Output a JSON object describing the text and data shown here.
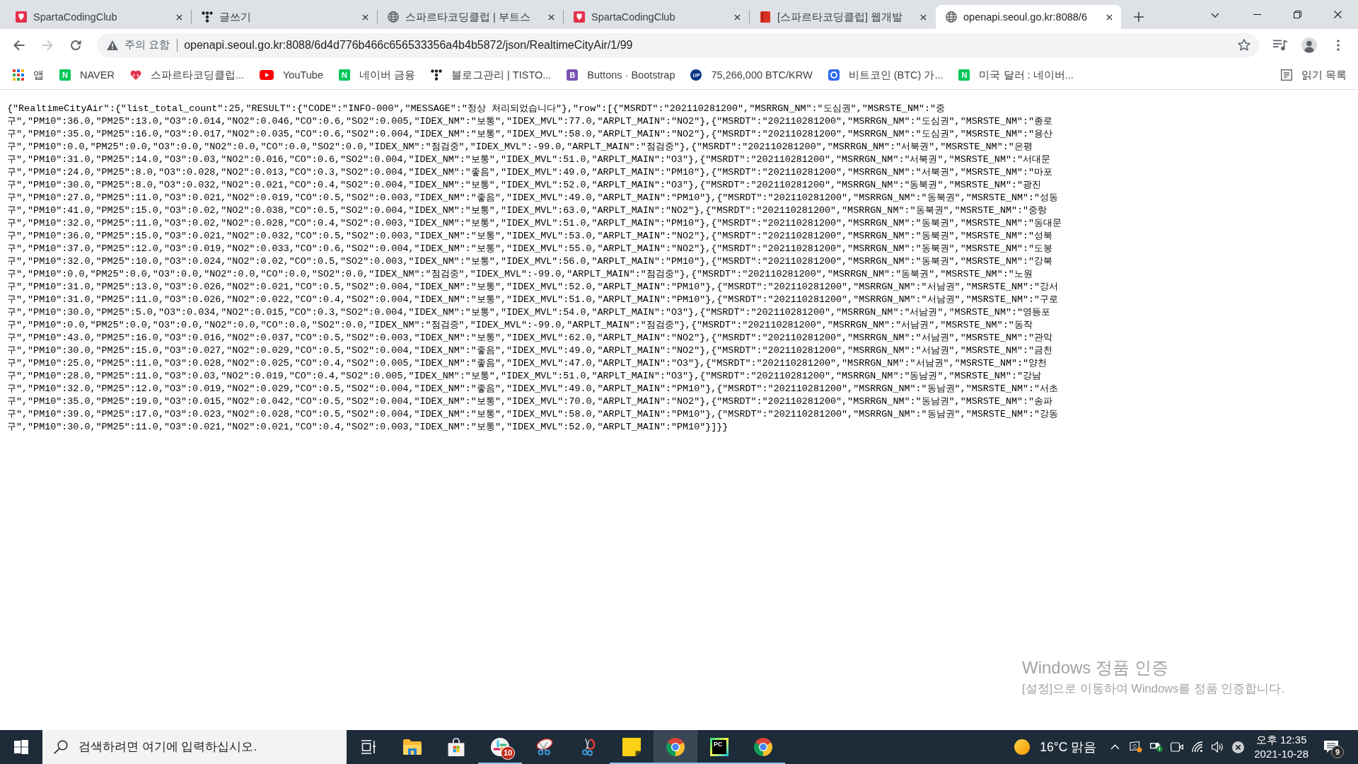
{
  "tabs": [
    {
      "title": "SpartaCodingClub",
      "kind": "sparta",
      "selected": false
    },
    {
      "title": "글쓰기",
      "kind": "tistory",
      "selected": false
    },
    {
      "title": "스파르타코딩클럽 | 부트스",
      "kind": "globe",
      "selected": false
    },
    {
      "title": "SpartaCodingClub",
      "kind": "sparta",
      "selected": false
    },
    {
      "title": "[스파르타코딩클럽] 웹개발",
      "kind": "book",
      "selected": false
    },
    {
      "title": "openapi.seoul.go.kr:8088/6",
      "kind": "globe",
      "selected": true
    }
  ],
  "nav_buttons": [
    {
      "kind": "back",
      "disabled": false
    },
    {
      "kind": "forward",
      "disabled": true
    },
    {
      "kind": "reload",
      "disabled": false
    }
  ],
  "address_bar": {
    "security_label": "주의 요함",
    "url": "openapi.seoul.go.kr:8088/6d4d776b466c656533356a4b4b5872/json/RealtimeCityAir/1/99",
    "bookmarked": false
  },
  "bookmarks": [
    {
      "label": "앱",
      "kind": "apps"
    },
    {
      "label": "NAVER",
      "kind": "naver",
      "glyph": "N"
    },
    {
      "label": "스파르타코딩클럽...",
      "kind": "heart"
    },
    {
      "label": "YouTube",
      "kind": "youtube"
    },
    {
      "label": "네이버 금융",
      "kind": "naver",
      "glyph": "N"
    },
    {
      "label": "블로그관리 | TISTO...",
      "kind": "tistory"
    },
    {
      "label": "Buttons · Bootstrap",
      "kind": "bootstrap",
      "glyph": "B"
    },
    {
      "label": "75,266,000 BTC/KRW",
      "kind": "upbit",
      "glyph": "UP"
    },
    {
      "label": "비트코인 (BTC) 가...",
      "kind": "coin"
    },
    {
      "label": "미국 달러 : 네이버...",
      "kind": "naver",
      "glyph": "N"
    }
  ],
  "reading_list": {
    "label": "읽기 목록"
  },
  "page": {
    "lines": [
      "{\"RealtimeCityAir\":{\"list_total_count\":25,\"RESULT\":{\"CODE\":\"INFO-000\",\"MESSAGE\":\"정상 처리되었습니다\"},\"row\":[{\"MSRDT\":\"202110281200\",\"MSRRGN_NM\":\"도심권\",\"MSRSTE_NM\":\"중",
      "구\",\"PM10\":36.0,\"PM25\":13.0,\"O3\":0.014,\"NO2\":0.046,\"CO\":0.6,\"SO2\":0.005,\"IDEX_NM\":\"보통\",\"IDEX_MVL\":77.0,\"ARPLT_MAIN\":\"NO2\"},{\"MSRDT\":\"202110281200\",\"MSRRGN_NM\":\"도심권\",\"MSRSTE_NM\":\"종로",
      "구\",\"PM10\":35.0,\"PM25\":16.0,\"O3\":0.017,\"NO2\":0.035,\"CO\":0.6,\"SO2\":0.004,\"IDEX_NM\":\"보통\",\"IDEX_MVL\":58.0,\"ARPLT_MAIN\":\"NO2\"},{\"MSRDT\":\"202110281200\",\"MSRRGN_NM\":\"도심권\",\"MSRSTE_NM\":\"용산",
      "구\",\"PM10\":0.0,\"PM25\":0.0,\"O3\":0.0,\"NO2\":0.0,\"CO\":0.0,\"SO2\":0.0,\"IDEX_NM\":\"점검중\",\"IDEX_MVL\":-99.0,\"ARPLT_MAIN\":\"점검중\"},{\"MSRDT\":\"202110281200\",\"MSRRGN_NM\":\"서북권\",\"MSRSTE_NM\":\"은평",
      "구\",\"PM10\":31.0,\"PM25\":14.0,\"O3\":0.03,\"NO2\":0.016,\"CO\":0.6,\"SO2\":0.004,\"IDEX_NM\":\"보통\",\"IDEX_MVL\":51.0,\"ARPLT_MAIN\":\"O3\"},{\"MSRDT\":\"202110281200\",\"MSRRGN_NM\":\"서북권\",\"MSRSTE_NM\":\"서대문",
      "구\",\"PM10\":24.0,\"PM25\":8.0,\"O3\":0.028,\"NO2\":0.013,\"CO\":0.3,\"SO2\":0.004,\"IDEX_NM\":\"좋음\",\"IDEX_MVL\":49.0,\"ARPLT_MAIN\":\"PM10\"},{\"MSRDT\":\"202110281200\",\"MSRRGN_NM\":\"서북권\",\"MSRSTE_NM\":\"마포",
      "구\",\"PM10\":30.0,\"PM25\":8.0,\"O3\":0.032,\"NO2\":0.021,\"CO\":0.4,\"SO2\":0.004,\"IDEX_NM\":\"보통\",\"IDEX_MVL\":52.0,\"ARPLT_MAIN\":\"O3\"},{\"MSRDT\":\"202110281200\",\"MSRRGN_NM\":\"동북권\",\"MSRSTE_NM\":\"광진",
      "구\",\"PM10\":27.0,\"PM25\":11.0,\"O3\":0.021,\"NO2\":0.019,\"CO\":0.5,\"SO2\":0.003,\"IDEX_NM\":\"좋음\",\"IDEX_MVL\":49.0,\"ARPLT_MAIN\":\"PM10\"},{\"MSRDT\":\"202110281200\",\"MSRRGN_NM\":\"동북권\",\"MSRSTE_NM\":\"성동",
      "구\",\"PM10\":41.0,\"PM25\":15.0,\"O3\":0.02,\"NO2\":0.038,\"CO\":0.5,\"SO2\":0.004,\"IDEX_NM\":\"보통\",\"IDEX_MVL\":63.0,\"ARPLT_MAIN\":\"NO2\"},{\"MSRDT\":\"202110281200\",\"MSRRGN_NM\":\"동북권\",\"MSRSTE_NM\":\"중랑",
      "구\",\"PM10\":32.0,\"PM25\":11.0,\"O3\":0.02,\"NO2\":0.028,\"CO\":0.4,\"SO2\":0.003,\"IDEX_NM\":\"보통\",\"IDEX_MVL\":51.0,\"ARPLT_MAIN\":\"PM10\"},{\"MSRDT\":\"202110281200\",\"MSRRGN_NM\":\"동북권\",\"MSRSTE_NM\":\"동대문",
      "구\",\"PM10\":36.0,\"PM25\":15.0,\"O3\":0.021,\"NO2\":0.032,\"CO\":0.5,\"SO2\":0.003,\"IDEX_NM\":\"보통\",\"IDEX_MVL\":53.0,\"ARPLT_MAIN\":\"NO2\"},{\"MSRDT\":\"202110281200\",\"MSRRGN_NM\":\"동북권\",\"MSRSTE_NM\":\"성북",
      "구\",\"PM10\":37.0,\"PM25\":12.0,\"O3\":0.019,\"NO2\":0.033,\"CO\":0.6,\"SO2\":0.004,\"IDEX_NM\":\"보통\",\"IDEX_MVL\":55.0,\"ARPLT_MAIN\":\"NO2\"},{\"MSRDT\":\"202110281200\",\"MSRRGN_NM\":\"동북권\",\"MSRSTE_NM\":\"도봉",
      "구\",\"PM10\":32.0,\"PM25\":10.0,\"O3\":0.024,\"NO2\":0.02,\"CO\":0.5,\"SO2\":0.003,\"IDEX_NM\":\"보통\",\"IDEX_MVL\":56.0,\"ARPLT_MAIN\":\"PM10\"},{\"MSRDT\":\"202110281200\",\"MSRRGN_NM\":\"동북권\",\"MSRSTE_NM\":\"강북",
      "구\",\"PM10\":0.0,\"PM25\":0.0,\"O3\":0.0,\"NO2\":0.0,\"CO\":0.0,\"SO2\":0.0,\"IDEX_NM\":\"점검중\",\"IDEX_MVL\":-99.0,\"ARPLT_MAIN\":\"점검중\"},{\"MSRDT\":\"202110281200\",\"MSRRGN_NM\":\"동북권\",\"MSRSTE_NM\":\"노원",
      "구\",\"PM10\":31.0,\"PM25\":13.0,\"O3\":0.026,\"NO2\":0.021,\"CO\":0.5,\"SO2\":0.004,\"IDEX_NM\":\"보통\",\"IDEX_MVL\":52.0,\"ARPLT_MAIN\":\"PM10\"},{\"MSRDT\":\"202110281200\",\"MSRRGN_NM\":\"서남권\",\"MSRSTE_NM\":\"강서",
      "구\",\"PM10\":31.0,\"PM25\":11.0,\"O3\":0.026,\"NO2\":0.022,\"CO\":0.4,\"SO2\":0.004,\"IDEX_NM\":\"보통\",\"IDEX_MVL\":51.0,\"ARPLT_MAIN\":\"PM10\"},{\"MSRDT\":\"202110281200\",\"MSRRGN_NM\":\"서남권\",\"MSRSTE_NM\":\"구로",
      "구\",\"PM10\":30.0,\"PM25\":5.0,\"O3\":0.034,\"NO2\":0.015,\"CO\":0.3,\"SO2\":0.004,\"IDEX_NM\":\"보통\",\"IDEX_MVL\":54.0,\"ARPLT_MAIN\":\"O3\"},{\"MSRDT\":\"202110281200\",\"MSRRGN_NM\":\"서남권\",\"MSRSTE_NM\":\"영등포",
      "구\",\"PM10\":0.0,\"PM25\":0.0,\"O3\":0.0,\"NO2\":0.0,\"CO\":0.0,\"SO2\":0.0,\"IDEX_NM\":\"점검중\",\"IDEX_MVL\":-99.0,\"ARPLT_MAIN\":\"점검중\"},{\"MSRDT\":\"202110281200\",\"MSRRGN_NM\":\"서남권\",\"MSRSTE_NM\":\"동작",
      "구\",\"PM10\":43.0,\"PM25\":16.0,\"O3\":0.016,\"NO2\":0.037,\"CO\":0.5,\"SO2\":0.003,\"IDEX_NM\":\"보통\",\"IDEX_MVL\":62.0,\"ARPLT_MAIN\":\"NO2\"},{\"MSRDT\":\"202110281200\",\"MSRRGN_NM\":\"서남권\",\"MSRSTE_NM\":\"관악",
      "구\",\"PM10\":30.0,\"PM25\":15.0,\"O3\":0.027,\"NO2\":0.029,\"CO\":0.5,\"SO2\":0.004,\"IDEX_NM\":\"좋음\",\"IDEX_MVL\":49.0,\"ARPLT_MAIN\":\"NO2\"},{\"MSRDT\":\"202110281200\",\"MSRRGN_NM\":\"서남권\",\"MSRSTE_NM\":\"금천",
      "구\",\"PM10\":25.0,\"PM25\":11.0,\"O3\":0.028,\"NO2\":0.025,\"CO\":0.4,\"SO2\":0.005,\"IDEX_NM\":\"좋음\",\"IDEX_MVL\":47.0,\"ARPLT_MAIN\":\"O3\"},{\"MSRDT\":\"202110281200\",\"MSRRGN_NM\":\"서남권\",\"MSRSTE_NM\":\"양천",
      "구\",\"PM10\":28.0,\"PM25\":11.0,\"O3\":0.03,\"NO2\":0.019,\"CO\":0.4,\"SO2\":0.005,\"IDEX_NM\":\"보통\",\"IDEX_MVL\":51.0,\"ARPLT_MAIN\":\"O3\"},{\"MSRDT\":\"202110281200\",\"MSRRGN_NM\":\"동남권\",\"MSRSTE_NM\":\"강남",
      "구\",\"PM10\":32.0,\"PM25\":12.0,\"O3\":0.019,\"NO2\":0.029,\"CO\":0.5,\"SO2\":0.004,\"IDEX_NM\":\"좋음\",\"IDEX_MVL\":49.0,\"ARPLT_MAIN\":\"PM10\"},{\"MSRDT\":\"202110281200\",\"MSRRGN_NM\":\"동남권\",\"MSRSTE_NM\":\"서초",
      "구\",\"PM10\":35.0,\"PM25\":19.0,\"O3\":0.015,\"NO2\":0.042,\"CO\":0.5,\"SO2\":0.004,\"IDEX_NM\":\"보통\",\"IDEX_MVL\":70.0,\"ARPLT_MAIN\":\"NO2\"},{\"MSRDT\":\"202110281200\",\"MSRRGN_NM\":\"동남권\",\"MSRSTE_NM\":\"송파",
      "구\",\"PM10\":39.0,\"PM25\":17.0,\"O3\":0.023,\"NO2\":0.028,\"CO\":0.5,\"SO2\":0.004,\"IDEX_NM\":\"보통\",\"IDEX_MVL\":58.0,\"ARPLT_MAIN\":\"PM10\"},{\"MSRDT\":\"202110281200\",\"MSRRGN_NM\":\"동남권\",\"MSRSTE_NM\":\"강동",
      "구\",\"PM10\":30.0,\"PM25\":11.0,\"O3\":0.021,\"NO2\":0.021,\"CO\":0.4,\"SO2\":0.003,\"IDEX_NM\":\"보통\",\"IDEX_MVL\":52.0,\"ARPLT_MAIN\":\"PM10\"}]}}"
    ]
  },
  "activation_notice": {
    "title": "Windows 정품 인증",
    "message": "[설정]으로 이동하여 Windows를 정품 인증합니다."
  },
  "taskbar": {
    "search": {
      "placeholder": "검색하려면 여기에 입력하십시오."
    },
    "apps": [
      {
        "kind": "task-view",
        "running": false,
        "selected": false
      },
      {
        "kind": "explorer",
        "running": false,
        "selected": false
      },
      {
        "kind": "store",
        "running": false,
        "selected": false
      },
      {
        "kind": "chat",
        "badge": "10",
        "running": true,
        "selected": false
      },
      {
        "kind": "snip",
        "running": false,
        "selected": false
      },
      {
        "kind": "sketch",
        "running": false,
        "selected": false
      },
      {
        "kind": "sticky-notes",
        "running": true,
        "selected": false
      },
      {
        "kind": "chrome",
        "running": true,
        "selected": true
      },
      {
        "kind": "pycharm",
        "glyph": "PC",
        "running": true,
        "selected": false
      },
      {
        "kind": "chrome",
        "running": true,
        "selected": false
      }
    ],
    "weather": {
      "text": "16°C 맑음"
    },
    "clock": {
      "time": "오후 12:35",
      "date": "2021-10-28"
    },
    "notifications": {
      "count": "9"
    }
  }
}
